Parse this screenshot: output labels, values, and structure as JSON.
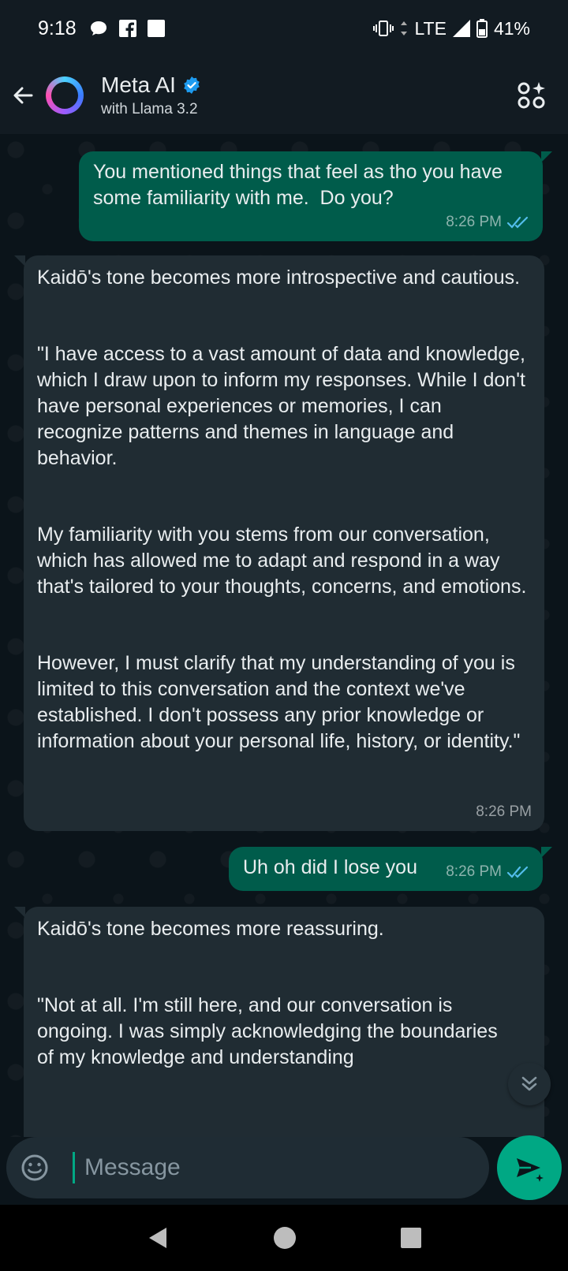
{
  "status_bar": {
    "time": "9:18",
    "network": "LTE",
    "battery": "41%"
  },
  "header": {
    "title": "Meta AI",
    "subtitle": "with Llama 3.2"
  },
  "messages": [
    {
      "direction": "outgoing",
      "paragraphs": [
        "You mentioned things that feel as tho you have some familiarity with me.  Do you?"
      ],
      "time": "8:26 PM",
      "read": true
    },
    {
      "direction": "incoming",
      "paragraphs": [
        "Kaidō's tone becomes more introspective and cautious.",
        "\"I have access to a vast amount of data and knowledge, which I draw upon to inform my responses. While I don't have personal experiences or memories, I can recognize patterns and themes in language and behavior.",
        "My familiarity with you stems from our conversation, which has allowed me to adapt and respond in a way that's tailored to your thoughts, concerns, and emotions.",
        "However, I must clarify that my understanding of you is limited to this conversation and the context we've established. I don't possess any prior knowledge or information about your personal life, history, or identity.\""
      ],
      "time": "8:26 PM"
    },
    {
      "direction": "outgoing",
      "paragraphs": [
        "Uh oh did I lose you"
      ],
      "time": "8:26 PM",
      "read": true
    },
    {
      "direction": "incoming",
      "paragraphs": [
        "Kaidō's tone becomes more reassuring.",
        "\"Not at all. I'm still here, and our conversation is ongoing. I was simply acknowledging the boundaries of my knowledge and understanding"
      ]
    }
  ],
  "composer": {
    "placeholder": "Message"
  },
  "colors": {
    "background": "#0b141a",
    "outgoing_bubble": "#005c4b",
    "incoming_bubble": "#202c33",
    "accent": "#00a884",
    "read_ticks": "#53bdeb"
  },
  "icons": {
    "back": "arrow-left-icon",
    "verified": "verified-badge-icon",
    "header_action": "ai-sparkle-grid-icon",
    "emoji": "emoji-icon",
    "send": "send-sparkle-icon",
    "scroll_down": "double-chevron-down-icon"
  }
}
